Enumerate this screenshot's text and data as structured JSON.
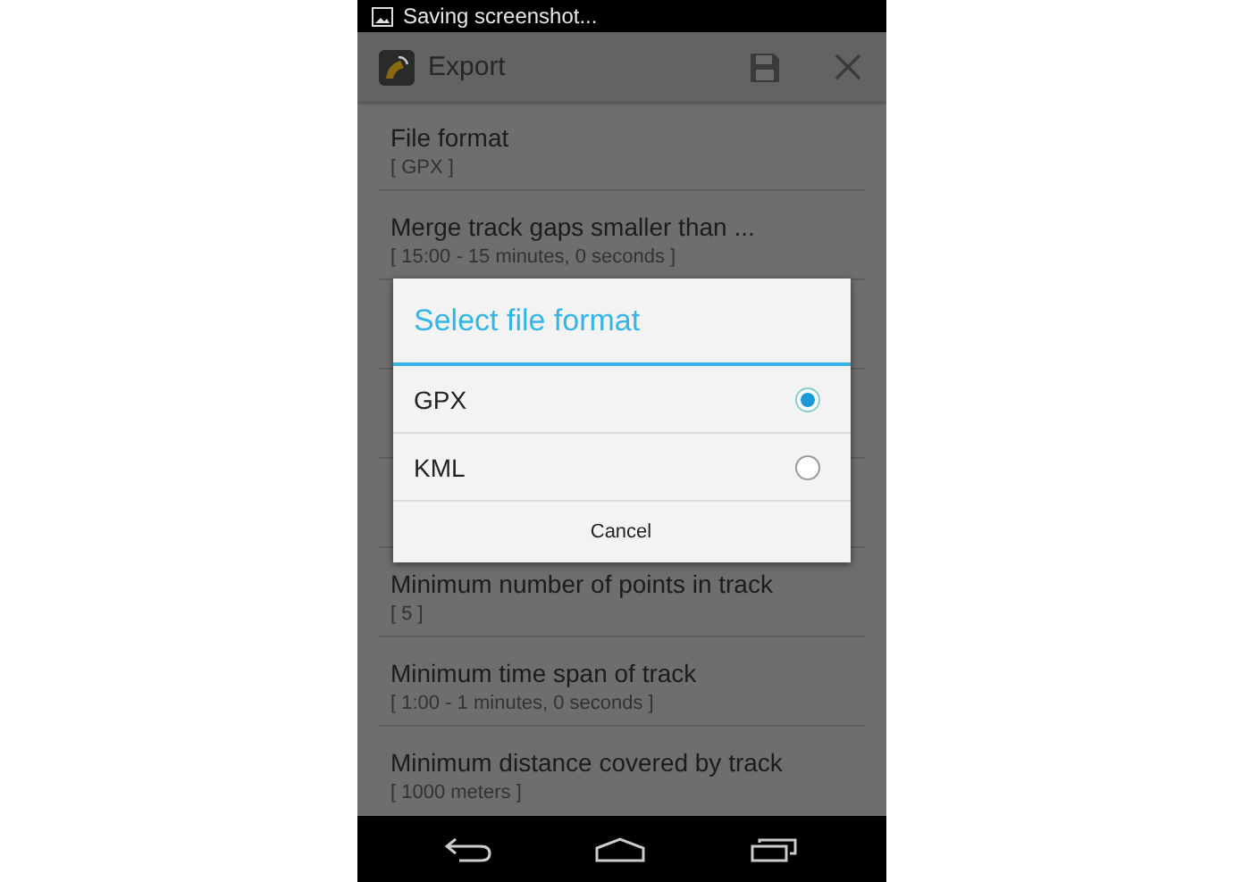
{
  "status_bar": {
    "notification": "Saving screenshot..."
  },
  "action_bar": {
    "title": "Export"
  },
  "settings_before": [
    {
      "title": "File format",
      "value": "[ GPX ]"
    },
    {
      "title": "Merge track gaps smaller than ...",
      "value": "[ 15:00 - 15 minutes, 0 seconds ]"
    }
  ],
  "settings_after": [
    {
      "title": "Minimum number of points in track",
      "value": "[ 5 ]"
    },
    {
      "title": "Minimum time span of track",
      "value": "[ 1:00 - 1 minutes, 0 seconds ]"
    },
    {
      "title": "Minimum distance covered by track",
      "value": "[ 1000 meters ]"
    }
  ],
  "dialog": {
    "title": "Select file format",
    "options": [
      {
        "label": "GPX",
        "selected": true
      },
      {
        "label": "KML",
        "selected": false
      }
    ],
    "cancel": "Cancel"
  }
}
